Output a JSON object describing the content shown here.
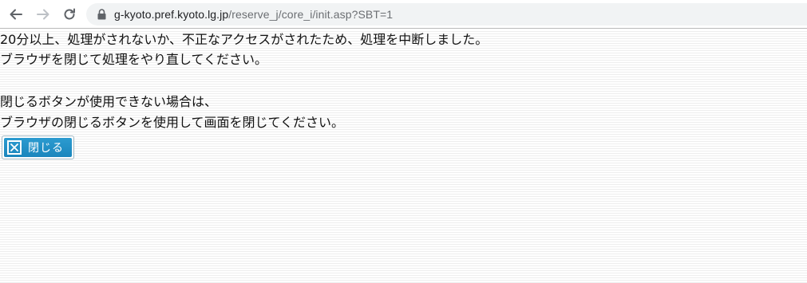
{
  "browser": {
    "url_host": "g-kyoto.pref.kyoto.lg.jp",
    "url_path": "/reserve_j/core_i/init.asp?SBT=1",
    "icons": {
      "back": "back-arrow-icon",
      "forward": "forward-arrow-icon",
      "reload": "reload-icon",
      "lock": "lock-icon"
    }
  },
  "message": {
    "line1": "20分以上、処理がされないか、不正なアクセスがされたため、処理を中断しました。",
    "line2": "ブラウザを閉じて処理をやり直してください。",
    "line3": "閉じるボタンが使用できない場合は、",
    "line4": "ブラウザの閉じるボタンを使用して画面を閉じてください。"
  },
  "close_button": {
    "label": "閉じる",
    "icon": "close-x-icon"
  },
  "colors": {
    "button_blue": "#1a86bd",
    "url_host": "#202124",
    "url_path": "#6b6e72",
    "address_bar_bg": "#f1f3f4"
  }
}
